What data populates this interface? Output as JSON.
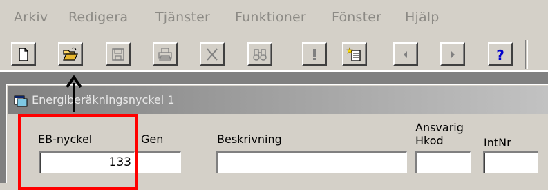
{
  "menu": [
    "Arkiv",
    "Redigera",
    "Tjänster",
    "Funktioner",
    "Fönster",
    "Hjälp"
  ],
  "toolbar": [
    {
      "name": "new-document-icon"
    },
    {
      "name": "open-folder-icon"
    },
    {
      "name": "save-disk-icon"
    },
    {
      "name": "print-icon"
    },
    {
      "name": "delete-x-icon"
    },
    {
      "name": "find-binoculars-icon"
    },
    {
      "name": "exclamation-icon"
    },
    {
      "name": "new-page-icon"
    },
    {
      "name": "previous-arrow-icon"
    },
    {
      "name": "next-arrow-icon"
    },
    {
      "name": "help-question-icon"
    }
  ],
  "window": {
    "title": "Energiberäkningsnyckel 1"
  },
  "form": {
    "eb_nyckel_label": "EB-nyckel",
    "eb_nyckel_value": "133",
    "gen_label": "Gen",
    "beskrivning_label": "Beskrivning",
    "ansvarig_label": "Ansvarig",
    "hkod_label": "Hkod",
    "intnr_label": "IntNr"
  },
  "colors": {
    "highlight": "#ff0000",
    "help_icon": "#0000cc"
  }
}
